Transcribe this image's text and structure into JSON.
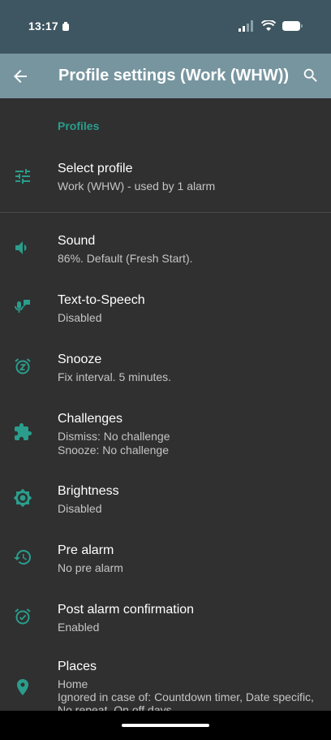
{
  "status_bar": {
    "time": "13:17"
  },
  "app_bar": {
    "title": "Profile settings (Work (WHW))"
  },
  "section": {
    "header": "Profiles"
  },
  "items": [
    {
      "label": "Select profile",
      "sub": [
        "Work (WHW) - used by 1 alarm"
      ],
      "icon": "tune-icon"
    },
    {
      "label": "Sound",
      "sub": [
        "86%. Default (Fresh Start)."
      ],
      "icon": "volume-icon"
    },
    {
      "label": "Text-to-Speech",
      "sub": [
        "Disabled"
      ],
      "icon": "voice-icon"
    },
    {
      "label": "Snooze",
      "sub": [
        "Fix interval. 5 minutes."
      ],
      "icon": "snooze-icon"
    },
    {
      "label": "Challenges",
      "sub": [
        "Dismiss: No challenge",
        "Snooze: No challenge"
      ],
      "icon": "puzzle-icon"
    },
    {
      "label": "Brightness",
      "sub": [
        "Disabled"
      ],
      "icon": "brightness-icon"
    },
    {
      "label": "Pre alarm",
      "sub": [
        "No pre alarm"
      ],
      "icon": "history-icon"
    },
    {
      "label": "Post alarm confirmation",
      "sub": [
        "Enabled"
      ],
      "icon": "alarm-check-icon"
    },
    {
      "label": "Places",
      "sub": [
        "Home",
        "Ignored in case of: Countdown timer, Date specific,",
        "No repeat, On off days"
      ],
      "icon": "location-icon"
    }
  ],
  "colors": {
    "accent": "#2a9d8c",
    "app_bar": "#77959f",
    "status_bar": "#3e5661",
    "background": "#303030"
  }
}
